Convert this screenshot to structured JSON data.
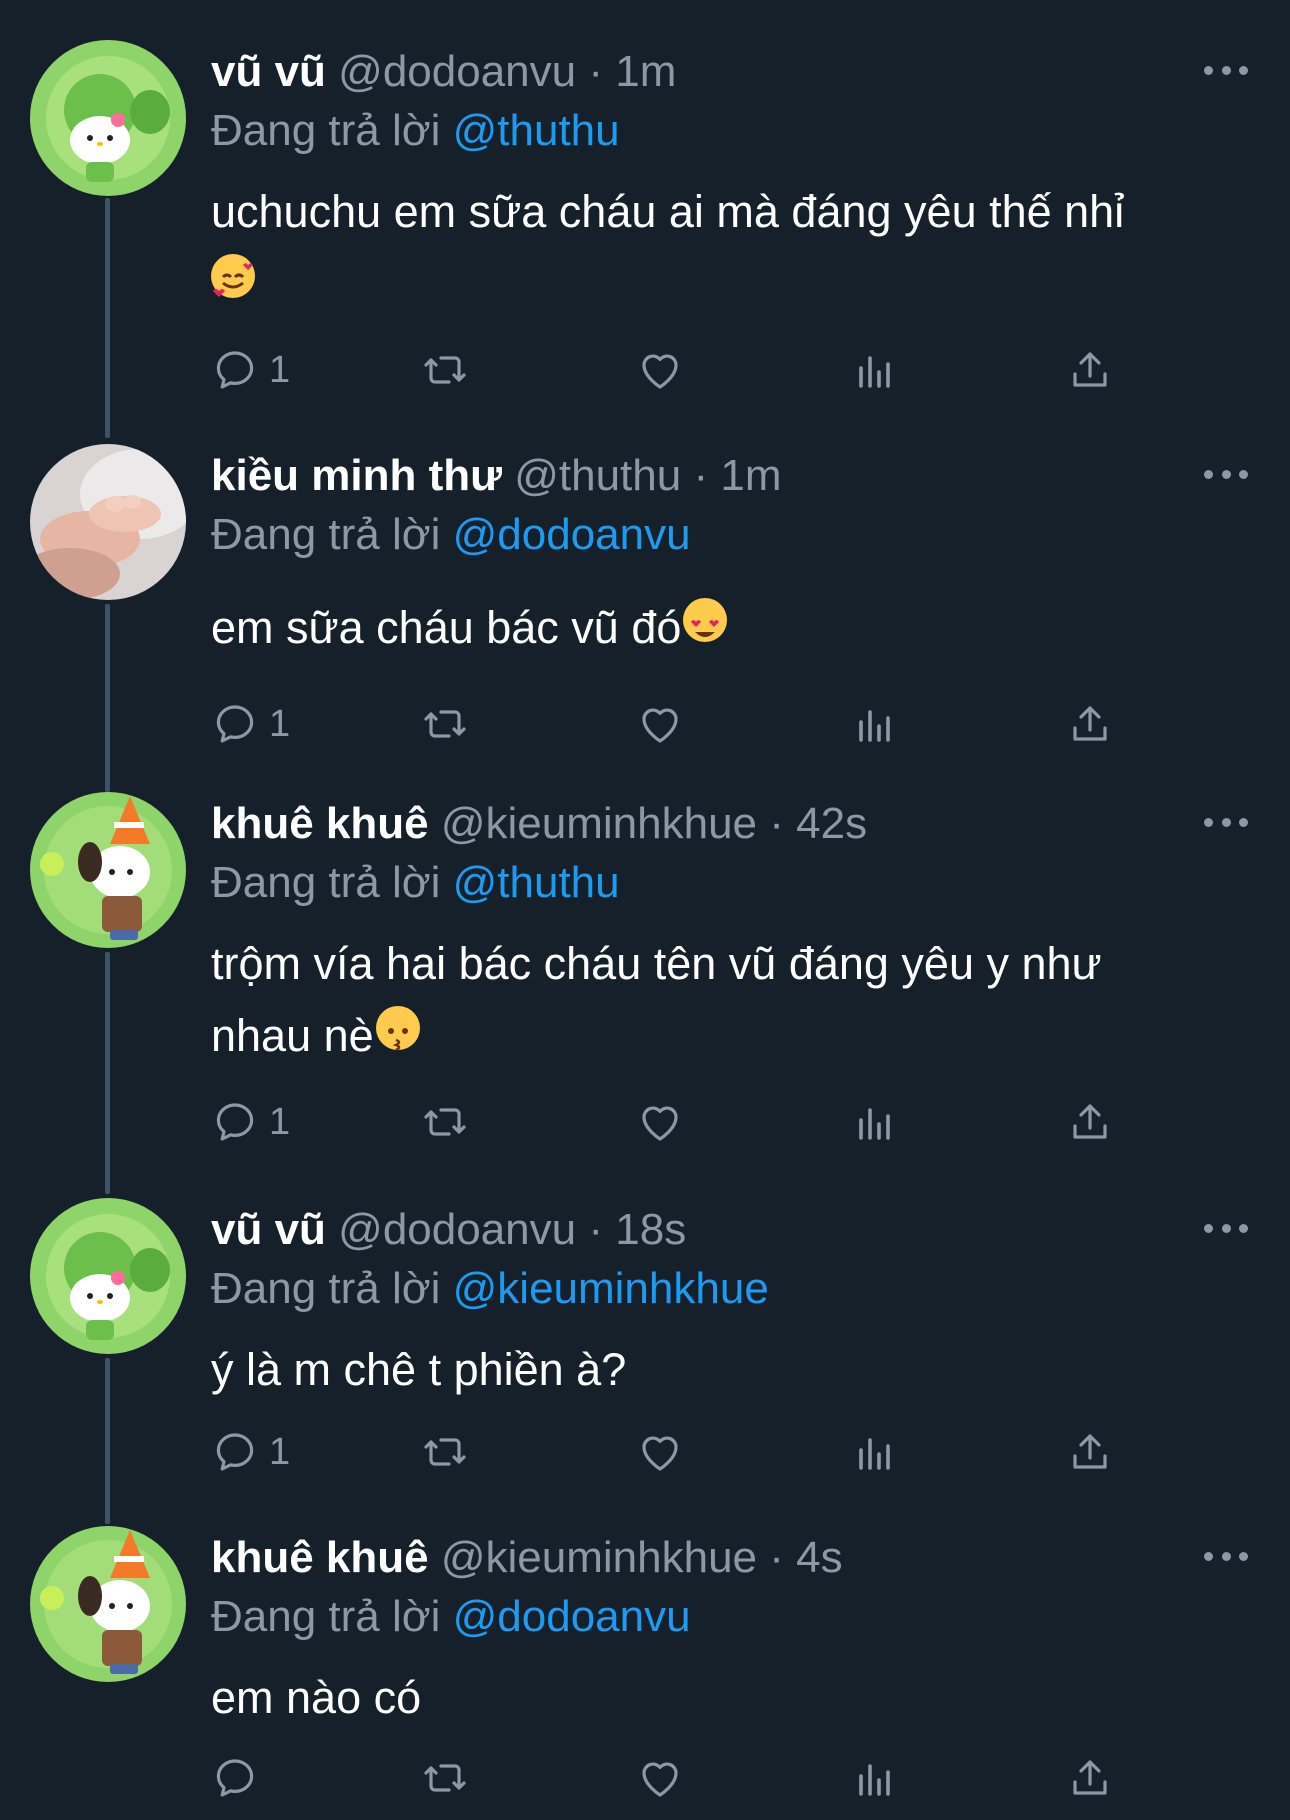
{
  "colors": {
    "background": "#15202b",
    "muted": "#8b98a5",
    "mention": "#1d9bf0",
    "text": "#ffffff"
  },
  "tweets": [
    {
      "name": "vũ vũ",
      "handle": "@dodoanvu",
      "separator": "·",
      "time": "1m",
      "replying_prefix": "Đang trả lời",
      "replying_to": "@thuthu",
      "text": "uchuchu em sữa cháu ai mà đáng yêu thế nhỉ",
      "emoji": "smiling-face-with-hearts",
      "reply_count": "1",
      "avatar": "hello-kitty-peashooter-avatar"
    },
    {
      "name": "kiều minh thư",
      "handle": "@thuthu",
      "separator": "·",
      "time": "1m",
      "replying_prefix": "Đang trả lời",
      "replying_to": "@dodoanvu",
      "text": "em sữa cháu bác vũ đó",
      "emoji": "heart-eyes",
      "reply_count": "1",
      "avatar": "baby-hands-photo-avatar"
    },
    {
      "name": "khuê khuê",
      "handle": "@kieuminhkhue",
      "separator": "·",
      "time": "42s",
      "replying_prefix": "Đang trả lời",
      "replying_to": "@thuthu",
      "text": "trộm vía hai bác cháu tên vũ đáng yêu y như nhau nè",
      "emoji": "kissing-face",
      "reply_count": "1",
      "avatar": "pochacco-cone-avatar"
    },
    {
      "name": "vũ vũ",
      "handle": "@dodoanvu",
      "separator": "·",
      "time": "18s",
      "replying_prefix": "Đang trả lời",
      "replying_to": "@kieuminhkhue",
      "text": "ý là m chê t phiền à?",
      "emoji": "",
      "reply_count": "1",
      "avatar": "hello-kitty-peashooter-avatar"
    },
    {
      "name": "khuê khuê",
      "handle": "@kieuminhkhue",
      "separator": "·",
      "time": "4s",
      "replying_prefix": "Đang trả lời",
      "replying_to": "@dodoanvu",
      "text": "em nào có",
      "emoji": "",
      "reply_count": "",
      "avatar": "pochacco-cone-avatar"
    }
  ]
}
